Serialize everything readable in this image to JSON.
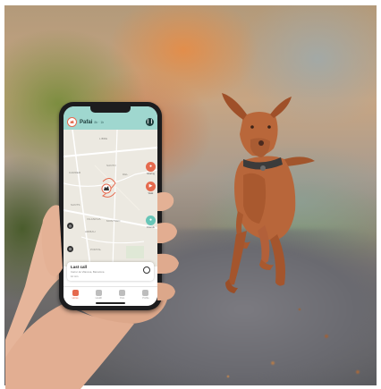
{
  "app": {
    "pet_name": "Pafai",
    "pet_sub": "8h · 1h",
    "header_btn_icon": "pause-icon"
  },
  "map": {
    "labels": [
      "LIBRE",
      "SANTO",
      "CARRER",
      "DEL",
      "SANTS",
      "VILANOVA",
      "ARIBAU",
      "MONTSEC",
      "PORTAL"
    ],
    "side_buttons": [
      {
        "label": "Sharing",
        "color": "#e56a4e"
      },
      {
        "label": "Walk",
        "color": "#e56a4e"
      },
      {
        "label": "Friends",
        "color": "#68c6b8"
      }
    ]
  },
  "card": {
    "title": "Last call",
    "subtitle": "Carrer de Vilanova, Barcelona",
    "extra": "12 min"
  },
  "tabs": [
    {
      "label": "Home",
      "active": true
    },
    {
      "label": "Health",
      "active": false
    },
    {
      "label": "Pets",
      "active": false
    },
    {
      "label": "Profile",
      "active": false
    }
  ],
  "colors": {
    "accent": "#e56a4e",
    "header_teal": "#9fd7cf",
    "map_bg": "#ece9e1"
  }
}
